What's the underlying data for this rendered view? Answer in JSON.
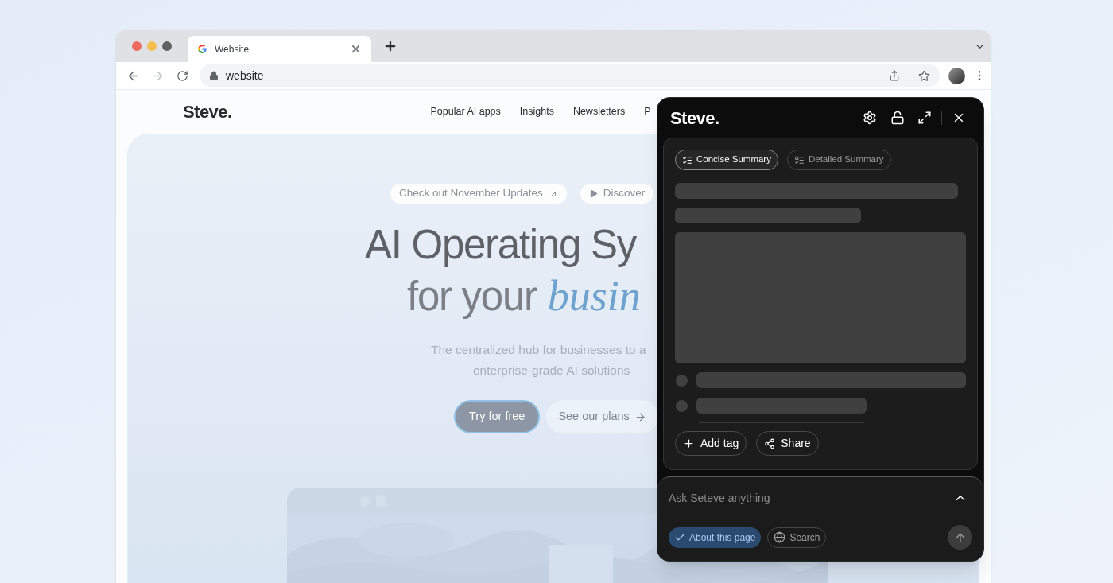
{
  "browser": {
    "tab": {
      "title": "Website"
    },
    "address": "website"
  },
  "site": {
    "logo": "Steve.",
    "nav": [
      "Popular AI apps",
      "Insights",
      "Newsletters",
      "P"
    ],
    "hero": {
      "chips": [
        {
          "kind": "link",
          "label": "Check out November Updates"
        },
        {
          "kind": "video",
          "label": "Discover"
        }
      ],
      "headline": "AI Operating Sy",
      "headline_2": "for your",
      "headline_accent": "busin",
      "subtitle": [
        "The centralized hub for businesses to a",
        "enterprise-grade AI solutions"
      ],
      "buttons": [
        {
          "kind": "primary",
          "label": "Try for free"
        },
        {
          "kind": "secondary",
          "label": "See our plans"
        }
      ]
    }
  },
  "panel": {
    "logo": "Steve.",
    "tabs": [
      {
        "label": "Concise Summary",
        "selected": true
      },
      {
        "label": "Detailed Summary",
        "selected": false
      }
    ],
    "actions": [
      {
        "kind": "add",
        "label": "Add tag"
      },
      {
        "kind": "share",
        "label": "Share"
      }
    ],
    "ask": {
      "placeholder": "Ask Seteve anything",
      "options": [
        {
          "kind": "check",
          "label": "About this page",
          "selected": true
        },
        {
          "kind": "globe",
          "label": "Search",
          "selected": false
        }
      ]
    }
  }
}
